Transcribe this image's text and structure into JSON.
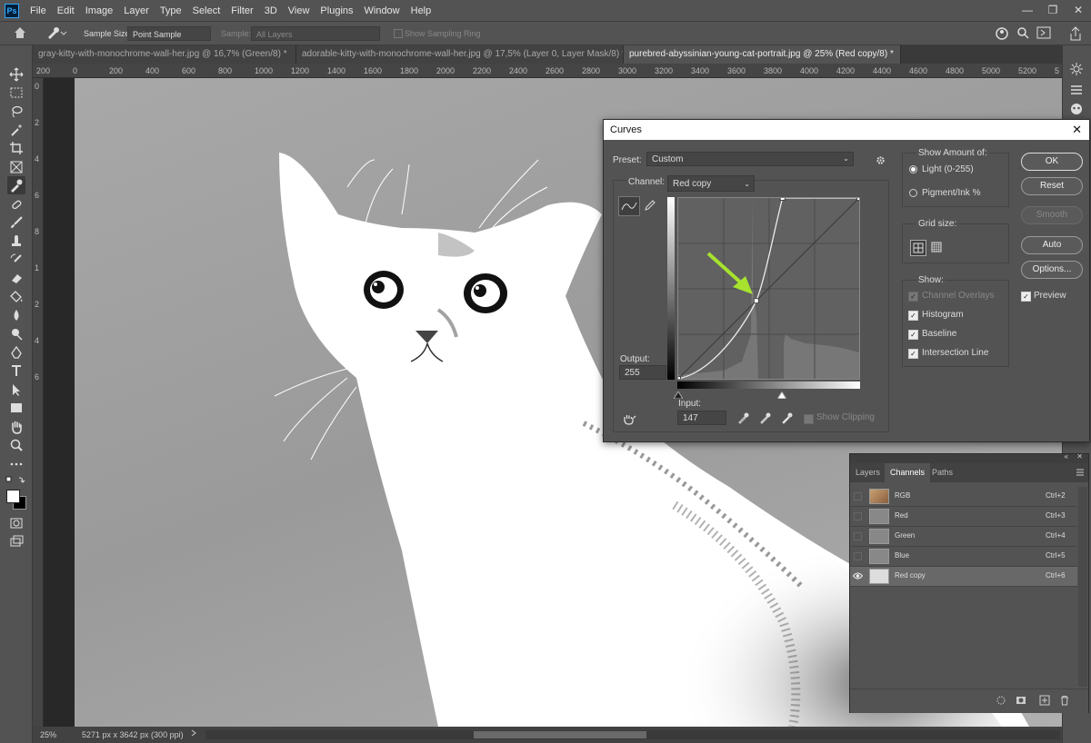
{
  "menu": {
    "logo": "Ps",
    "items": [
      "File",
      "Edit",
      "Image",
      "Layer",
      "Type",
      "Select",
      "Filter",
      "3D",
      "View",
      "Plugins",
      "Window",
      "Help"
    ],
    "window_controls": [
      "—",
      "❐",
      "✕"
    ]
  },
  "options": {
    "sample_size_label": "Sample Size:",
    "sample_size_value": "Point Sample",
    "sample_label": "Sample:",
    "sample_value": "All Layers",
    "sampling_ring_label": "Show Sampling Ring"
  },
  "tabs": [
    {
      "label": "gray-kitty-with-monochrome-wall-her.jpg @ 16,7% (Green/8) *",
      "close": "✕"
    },
    {
      "label": "adorable-kitty-with-monochrome-wall-her.jpg @ 17,5% (Layer 0, Layer Mask/8) *",
      "close": "✕"
    },
    {
      "label": "purebred-abyssinian-young-cat-portrait.jpg @ 25% (Red copy/8) *",
      "close": "✕"
    }
  ],
  "ruler": {
    "h_ticks": [
      "200",
      "0",
      "200",
      "400",
      "600",
      "800",
      "1000",
      "1200",
      "1400",
      "1600",
      "1800",
      "2000",
      "2200",
      "2400",
      "2600",
      "2800",
      "3000",
      "3200",
      "3400",
      "3600",
      "3800",
      "4000",
      "4200",
      "4400",
      "4600",
      "4800",
      "5000",
      "5200",
      "5"
    ],
    "v_ticks": [
      "0",
      "2",
      "4",
      "6",
      "8",
      "1",
      "2",
      "4",
      "6"
    ]
  },
  "status": {
    "zoom": "25%",
    "doc_info": "5271 px x 3642 px (300 ppi)"
  },
  "curves": {
    "title": "Curves",
    "close": "✕",
    "preset_label": "Preset:",
    "preset_value": "Custom",
    "channel_label": "Channel:",
    "channel_value": "Red copy",
    "output_label": "Output:",
    "output_value": "255",
    "input_label": "Input:",
    "input_value": "147",
    "show_clipping": "Show Clipping",
    "show_amount_label": "Show Amount of:",
    "light_label": "Light  (0-255)",
    "pigment_label": "Pigment/Ink %",
    "grid_size_label": "Grid size:",
    "show_label": "Show:",
    "show_items": [
      {
        "label": "Channel Overlays",
        "checked": true,
        "enabled": false
      },
      {
        "label": "Histogram",
        "checked": true,
        "enabled": true
      },
      {
        "label": "Baseline",
        "checked": true,
        "enabled": true
      },
      {
        "label": "Intersection Line",
        "checked": true,
        "enabled": true
      }
    ],
    "buttons": {
      "ok": "OK",
      "reset": "Reset",
      "smooth": "Smooth",
      "auto": "Auto",
      "options": "Options..."
    },
    "preview_label": "Preview",
    "check_mark": "✓",
    "curve_points": [
      [
        0,
        0
      ],
      [
        110,
        110
      ],
      [
        147,
        255
      ],
      [
        255,
        255
      ]
    ],
    "accent_color": "#a6e22e"
  },
  "channels": {
    "tabs": [
      "Layers",
      "Channels",
      "Paths"
    ],
    "rows": [
      {
        "name": "RGB",
        "shortcut": "Ctrl+2",
        "selected": false
      },
      {
        "name": "Red",
        "shortcut": "Ctrl+3",
        "selected": false
      },
      {
        "name": "Green",
        "shortcut": "Ctrl+4",
        "selected": false
      },
      {
        "name": "Blue",
        "shortcut": "Ctrl+5",
        "selected": false
      },
      {
        "name": "Red copy",
        "shortcut": "Ctrl+6",
        "selected": true
      }
    ]
  }
}
